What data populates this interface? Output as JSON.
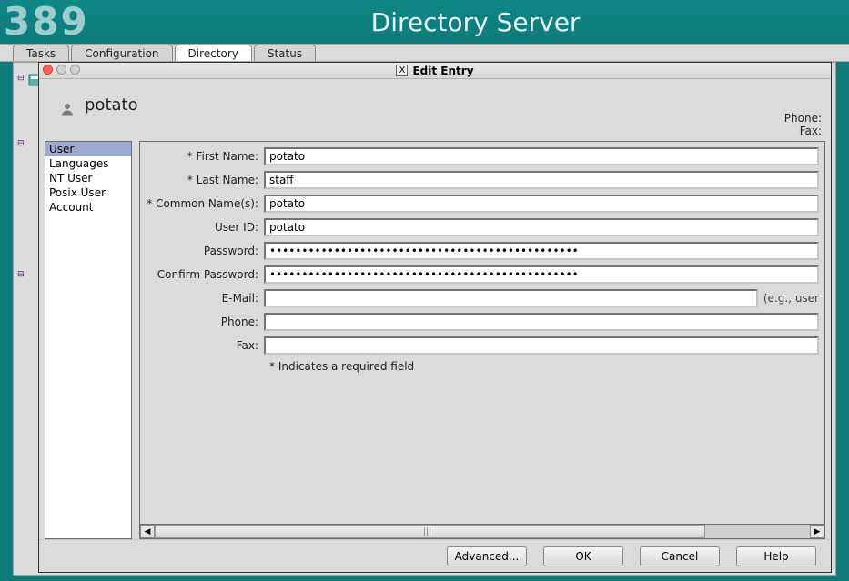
{
  "brand": {
    "logo": "389",
    "title": "Directory Server"
  },
  "tabs": {
    "items": [
      "Tasks",
      "Configuration",
      "Directory",
      "Status"
    ],
    "active": 2
  },
  "modal": {
    "title": "Edit Entry",
    "header": {
      "name": "potato",
      "phone_label": "Phone:",
      "fax_label": "Fax:"
    },
    "sidebar": {
      "items": [
        "User",
        "Languages",
        "NT User",
        "Posix User",
        "Account"
      ],
      "selected": 0
    },
    "form": {
      "first_name": {
        "label": "* First Name:",
        "value": "potato"
      },
      "last_name": {
        "label": "* Last Name:",
        "value": "staff"
      },
      "common_name": {
        "label": "* Common Name(s):",
        "value": "potato"
      },
      "user_id": {
        "label": "User ID:",
        "value": "potato"
      },
      "password": {
        "label": "Password:",
        "value": "................................................"
      },
      "confirm": {
        "label": "Confirm Password:",
        "value": "................................................"
      },
      "email": {
        "label": "E-Mail:",
        "value": "",
        "hint": "(e.g., user"
      },
      "phone": {
        "label": "Phone:",
        "value": ""
      },
      "fax": {
        "label": "Fax:",
        "value": ""
      },
      "required_note": "* Indicates a required field"
    },
    "buttons": {
      "advanced": "Advanced...",
      "ok": "OK",
      "cancel": "Cancel",
      "help": "Help"
    }
  }
}
